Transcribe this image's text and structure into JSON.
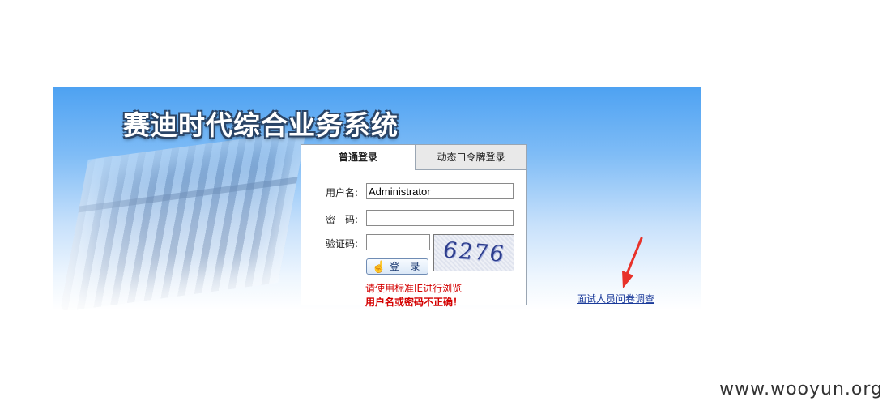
{
  "header": {
    "title": "赛迪时代综合业务系统"
  },
  "login": {
    "tabs": [
      {
        "label": "普通登录",
        "active": true
      },
      {
        "label": "动态口令牌登录",
        "active": false
      }
    ],
    "username_label": "用户名:",
    "username_value": "Administrator",
    "password_label": "密　码:",
    "password_value": "",
    "captcha_label": "验证码:",
    "captcha_value": "",
    "captcha_image_text": "6276",
    "login_button_label": "登 录",
    "browser_hint": "请使用标准IE进行浏览",
    "error_message": "用户名或密码不正确！"
  },
  "survey_link": "面试人员问卷调查",
  "watermark": "www.wooyun.org",
  "colors": {
    "banner_top": "#4ea2f2",
    "error_red": "#d40000",
    "link_blue": "#1a3a9a",
    "arrow_red": "#e8322a"
  }
}
